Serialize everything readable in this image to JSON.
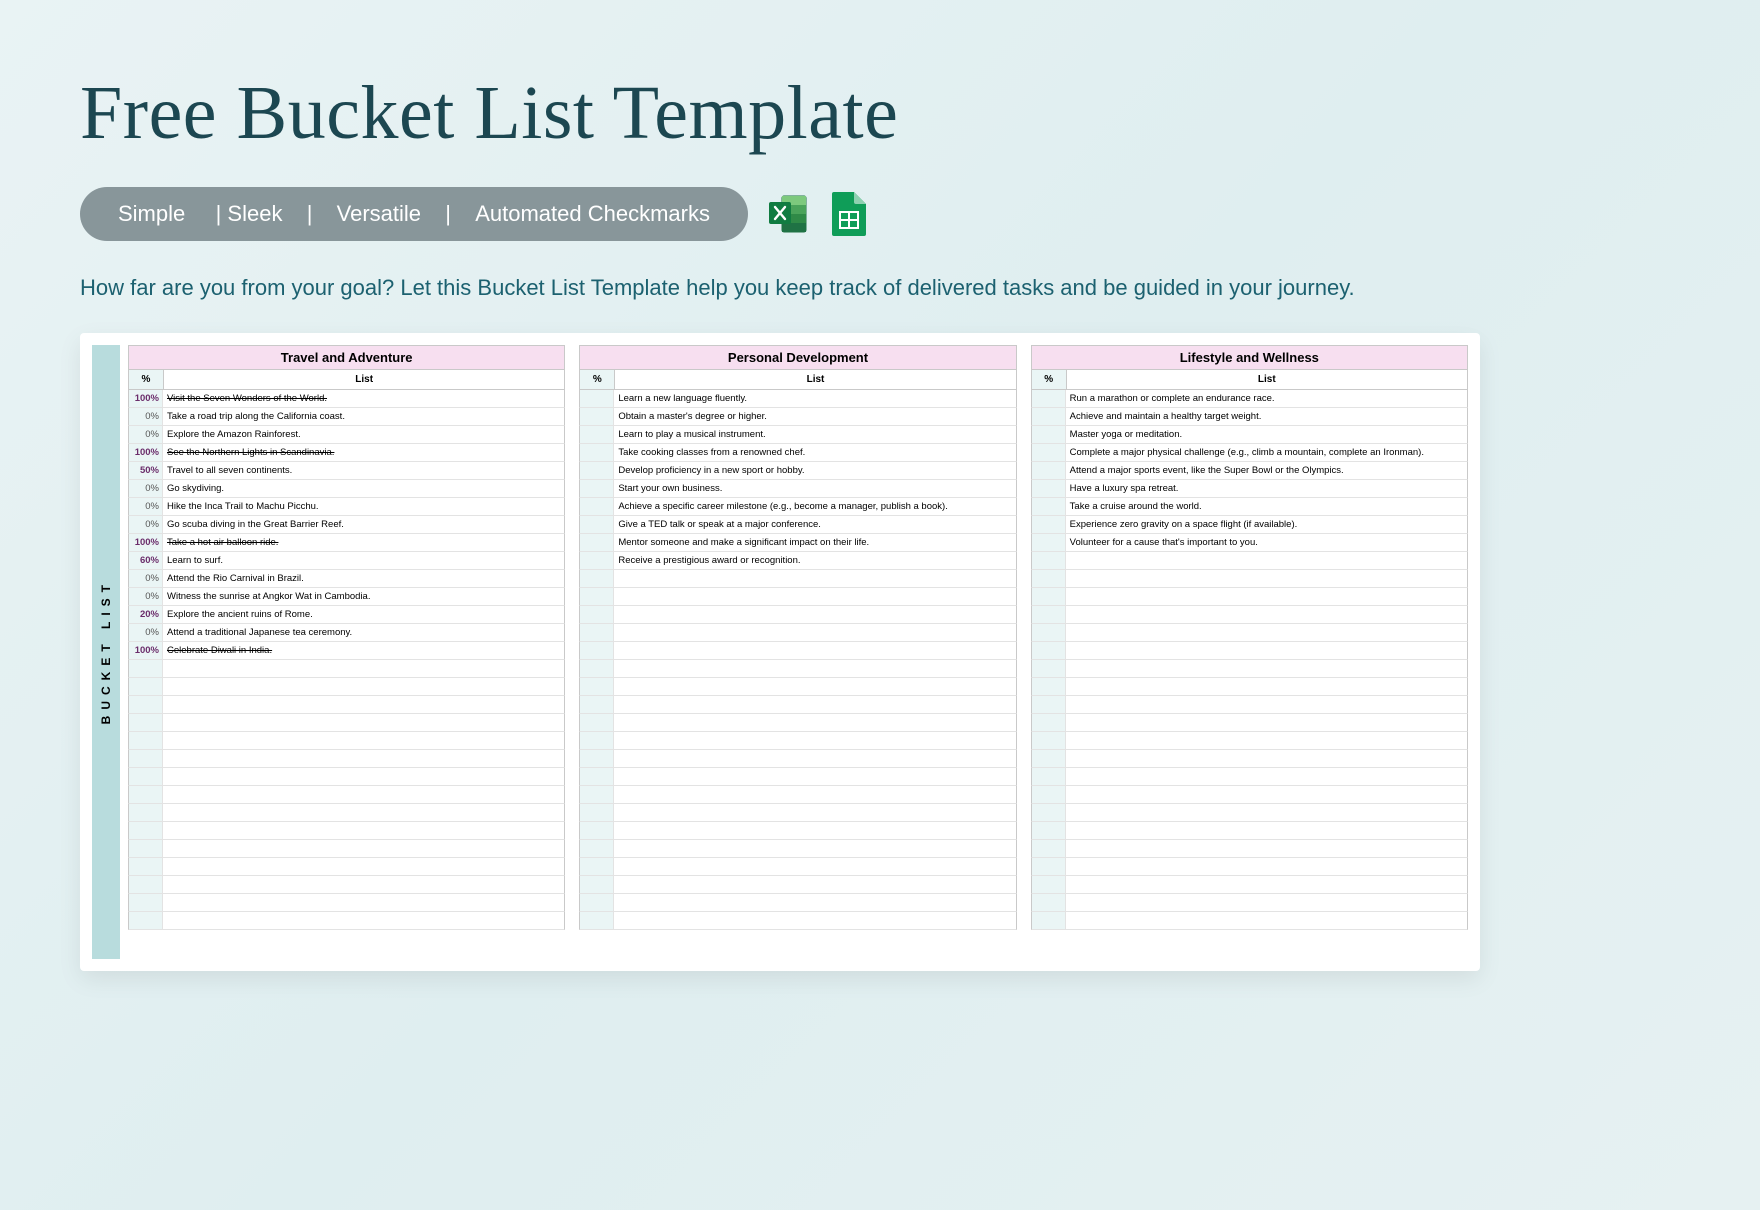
{
  "title": "Free Bucket List Template",
  "tags": {
    "items": [
      "Simple ",
      "| Sleek",
      "|",
      "Versatile",
      "|",
      "Automated Checkmarks"
    ]
  },
  "icons": {
    "excel": "excel-icon",
    "sheets": "google-sheets-icon"
  },
  "description": "How far are you from your goal? Let this Bucket List Template help you keep track of delivered tasks and be guided in your journey.",
  "preview": {
    "side_label": "BUCKET LIST",
    "col_headers": {
      "pct": "%",
      "list": "List"
    },
    "empty_rows_per_section": 30,
    "sections": [
      {
        "title": "Travel and Adventure",
        "items": [
          {
            "pct": "100%",
            "text": "Visit the Seven Wonders of the World.",
            "done": true
          },
          {
            "pct": "0%",
            "text": "Take a road trip along the California coast."
          },
          {
            "pct": "0%",
            "text": "Explore the Amazon Rainforest."
          },
          {
            "pct": "100%",
            "text": "See the Northern Lights in Scandinavia.",
            "done": true
          },
          {
            "pct": "50%",
            "text": "Travel to all seven continents."
          },
          {
            "pct": "0%",
            "text": "Go skydiving."
          },
          {
            "pct": "0%",
            "text": "Hike the Inca Trail to Machu Picchu."
          },
          {
            "pct": "0%",
            "text": "Go scuba diving in the Great Barrier Reef."
          },
          {
            "pct": "100%",
            "text": "Take a hot air balloon ride.",
            "done": true
          },
          {
            "pct": "60%",
            "text": "Learn to surf."
          },
          {
            "pct": "0%",
            "text": "Attend the Rio Carnival in Brazil."
          },
          {
            "pct": "0%",
            "text": "Witness the sunrise at Angkor Wat in Cambodia."
          },
          {
            "pct": "20%",
            "text": "Explore the ancient ruins of Rome."
          },
          {
            "pct": "0%",
            "text": "Attend a traditional Japanese tea ceremony."
          },
          {
            "pct": "100%",
            "text": "Celebrate Diwali in India.",
            "done": true
          }
        ]
      },
      {
        "title": "Personal Development",
        "items": [
          {
            "pct": "",
            "text": "Learn a new language fluently."
          },
          {
            "pct": "",
            "text": "Obtain a master's degree or higher."
          },
          {
            "pct": "",
            "text": "Learn to play a musical instrument."
          },
          {
            "pct": "",
            "text": "Take cooking classes from a renowned chef."
          },
          {
            "pct": "",
            "text": "Develop proficiency in a new sport or hobby."
          },
          {
            "pct": "",
            "text": "Start your own business."
          },
          {
            "pct": "",
            "text": "Achieve a specific career milestone (e.g., become a manager, publish a book)."
          },
          {
            "pct": "",
            "text": "Give a TED talk or speak at a major conference."
          },
          {
            "pct": "",
            "text": "Mentor someone and make a significant impact on their life."
          },
          {
            "pct": "",
            "text": "Receive a prestigious award or recognition."
          }
        ]
      },
      {
        "title": "Lifestyle and Wellness",
        "items": [
          {
            "pct": "",
            "text": "Run a marathon or complete an endurance race."
          },
          {
            "pct": "",
            "text": "Achieve and maintain a healthy target weight."
          },
          {
            "pct": "",
            "text": "Master yoga or meditation."
          },
          {
            "pct": "",
            "text": "Complete a major physical challenge (e.g., climb a mountain, complete an Ironman)."
          },
          {
            "pct": "",
            "text": "Attend a major sports event, like the Super Bowl or the Olympics."
          },
          {
            "pct": "",
            "text": "Have a luxury spa retreat."
          },
          {
            "pct": "",
            "text": "Take a cruise around the world."
          },
          {
            "pct": "",
            "text": "Experience zero gravity on a space flight (if available)."
          },
          {
            "pct": "",
            "text": "Volunteer for a cause that's important to you."
          }
        ]
      }
    ]
  }
}
